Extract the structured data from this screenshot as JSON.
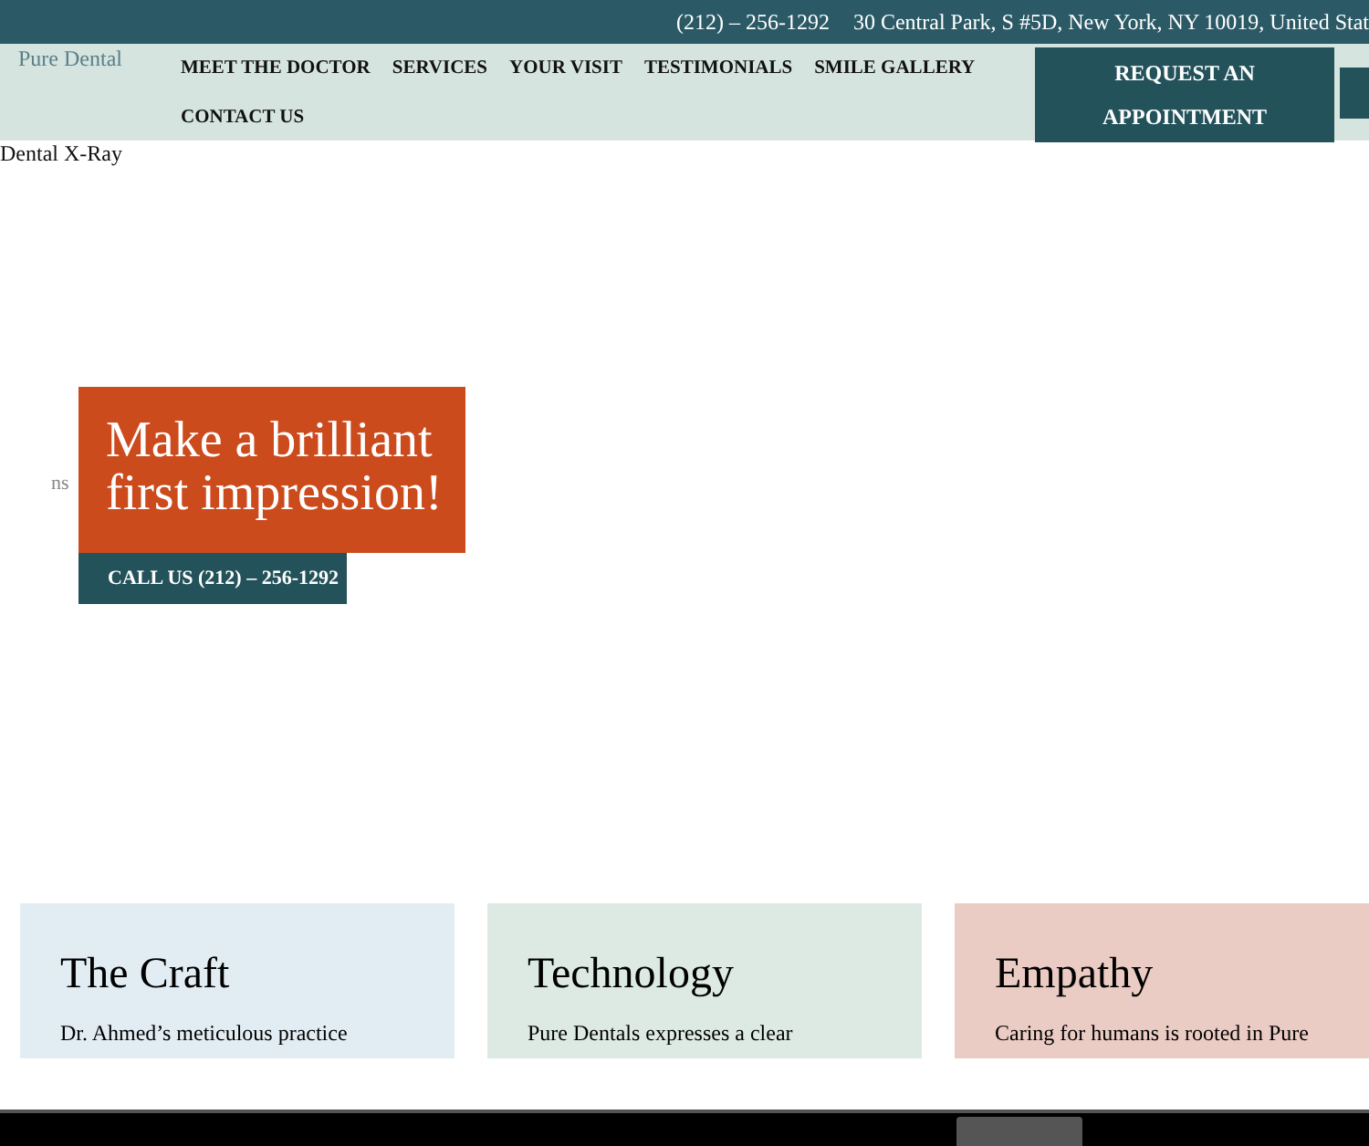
{
  "top_bar": {
    "phone": "(212) – 256-1292",
    "address": "30 Central Park, S #5D, New York, NY 10019, United Stat"
  },
  "header": {
    "logo_alt": "Pure Dental",
    "nav": [
      "MEET THE DOCTOR",
      "SERVICES",
      "YOUR VISIT",
      "TESTIMONIALS",
      "SMILE GALLERY",
      "CONTACT US"
    ],
    "cta": "REQUEST AN APPOINTMENT"
  },
  "hero": {
    "image_alt": "Dental X-Ray",
    "side_text": "ns",
    "headline": "Make a brilliant first impression!",
    "button": "CALL US (212) – 256-1292"
  },
  "cards": [
    {
      "title": "The Craft",
      "text": "Dr. Ahmed’s meticulous practice",
      "color": "#e2edf3"
    },
    {
      "title": "Technology",
      "text": "Pure Dentals expresses a clear",
      "color": "#dceae3"
    },
    {
      "title": "Empathy",
      "text": "Caring for humans is rooted in Pure",
      "color": "#ebccc4"
    }
  ]
}
